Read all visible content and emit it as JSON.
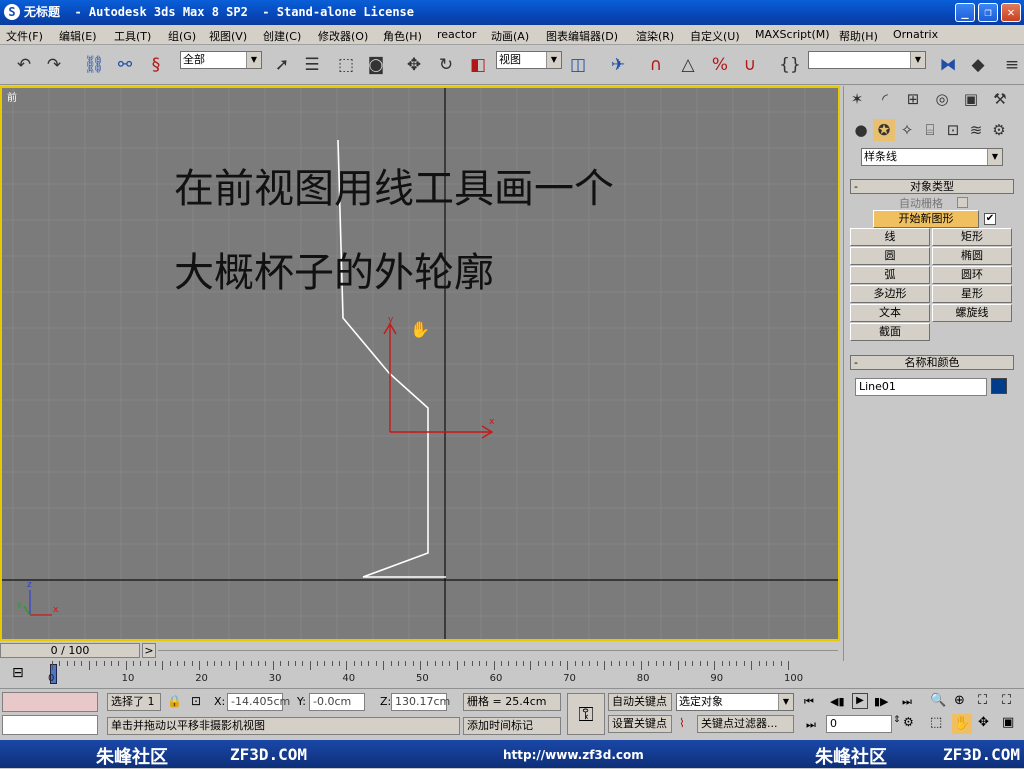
{
  "window": {
    "title": "无标题  - Autodesk 3ds Max 8 SP2  - Stand-alone License"
  },
  "menu": [
    "文件(F)",
    "编辑(E)",
    "工具(T)",
    "组(G)",
    "视图(V)",
    "创建(C)",
    "修改器(O)",
    "角色(H)",
    "reactor",
    "动画(A)",
    "图表编辑器(D)",
    "渲染(R)",
    "自定义(U)",
    "MAXScript(M)",
    "帮助(H)",
    "Ornatrix"
  ],
  "toolbar": {
    "selection_filter": "全部",
    "ref_coord": "视图",
    "named_selection": ""
  },
  "viewport": {
    "label": "前",
    "note_line1": "在前视图用线工具画一个",
    "note_line2": "大概杯子的外轮廓",
    "gizmo_y": "y",
    "gizmo_x": "x",
    "axis_z": "z",
    "axis_x": "x",
    "axis_y": "y",
    "colors": {
      "active_border": "#e8c800",
      "spline": "#ffffff",
      "gizmo": "#c81818",
      "background": "#7b7b7b"
    }
  },
  "command_panel": {
    "category": "样条线",
    "object_type_title": "对象类型",
    "auto_grid": "自动栅格",
    "start_new_shape": "开始新图形",
    "start_new_shape_checked": true,
    "buttons": [
      "线",
      "矩形",
      "圆",
      "椭圆",
      "弧",
      "圆环",
      "多边形",
      "星形",
      "文本",
      "螺旋线",
      "截面"
    ],
    "name_color_title": "名称和颜色",
    "object_name": "Line01",
    "object_color": "#003c8c",
    "rollout_marker": "-"
  },
  "timeline": {
    "frame": "0 / 100",
    "prev": "<",
    "next": ">",
    "ticks": [
      "0",
      "10",
      "20",
      "30",
      "40",
      "50",
      "60",
      "70",
      "80",
      "90",
      "100"
    ]
  },
  "status": {
    "selected": "选择了 1",
    "x_label": "X:",
    "x": "-14.405cm",
    "y_label": "Y:",
    "y": "-0.0cm",
    "z_label": "Z:",
    "z": "130.17cm",
    "grid": "栅格 = 25.4cm",
    "prompt": "单击并拖动以平移非摄影机视图",
    "add_time_tag": "添加时间标记",
    "auto_key": "自动关键点",
    "set_key": "设置关键点",
    "key_mode": "选定对象",
    "key_filters": "关键点过滤器...",
    "current_frame": "0"
  },
  "watermark": {
    "left_brand": "朱峰社区",
    "left_site": "ZF3D.COM",
    "url": "http://www.zf3d.com",
    "right_brand": "朱峰社区",
    "right_site": "ZF3D.COM"
  }
}
